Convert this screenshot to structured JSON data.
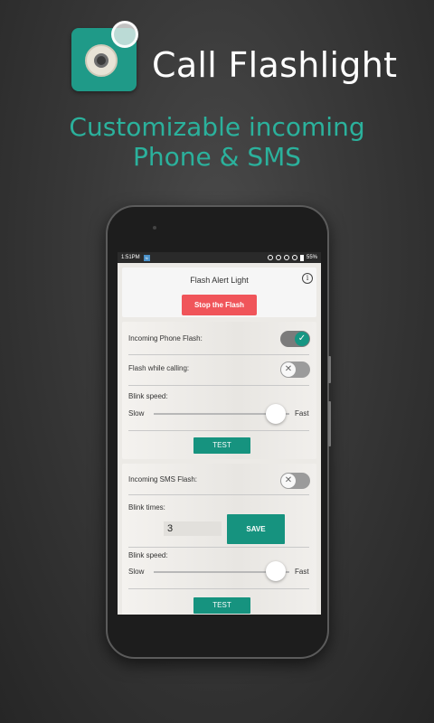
{
  "header": {
    "app_title": "Call Flashlight",
    "tagline_line1": "Customizable incoming",
    "tagline_line2": "Phone & SMS"
  },
  "colors": {
    "accent": "#16937f",
    "tagline": "#2bb19c",
    "stop_button": "#f0555a",
    "icon_bg": "#1f9a88"
  },
  "statusbar": {
    "time": "1:51PM",
    "notif": "N",
    "battery": "55%"
  },
  "app": {
    "title": "Flash Alert  Light",
    "info_glyph": "i",
    "stop_label": "Stop the Flash",
    "phone_section": {
      "incoming_label": "Incoming Phone Flash:",
      "incoming_on": true,
      "calling_label": "Flash while calling:",
      "calling_on": false,
      "blink_speed_label": "Blink speed:",
      "slow_label": "Slow",
      "fast_label": "Fast",
      "speed_fraction": 0.9,
      "test_label": "TEST"
    },
    "sms_section": {
      "incoming_label": "Incoming SMS Flash:",
      "incoming_on": false,
      "blink_times_label": "Blink times:",
      "blink_times_value": "3",
      "save_label": "SAVE",
      "blink_speed_label": "Blink speed:",
      "slow_label": "Slow",
      "fast_label": "Fast",
      "speed_fraction": 0.9,
      "test_label": "TEST"
    }
  }
}
